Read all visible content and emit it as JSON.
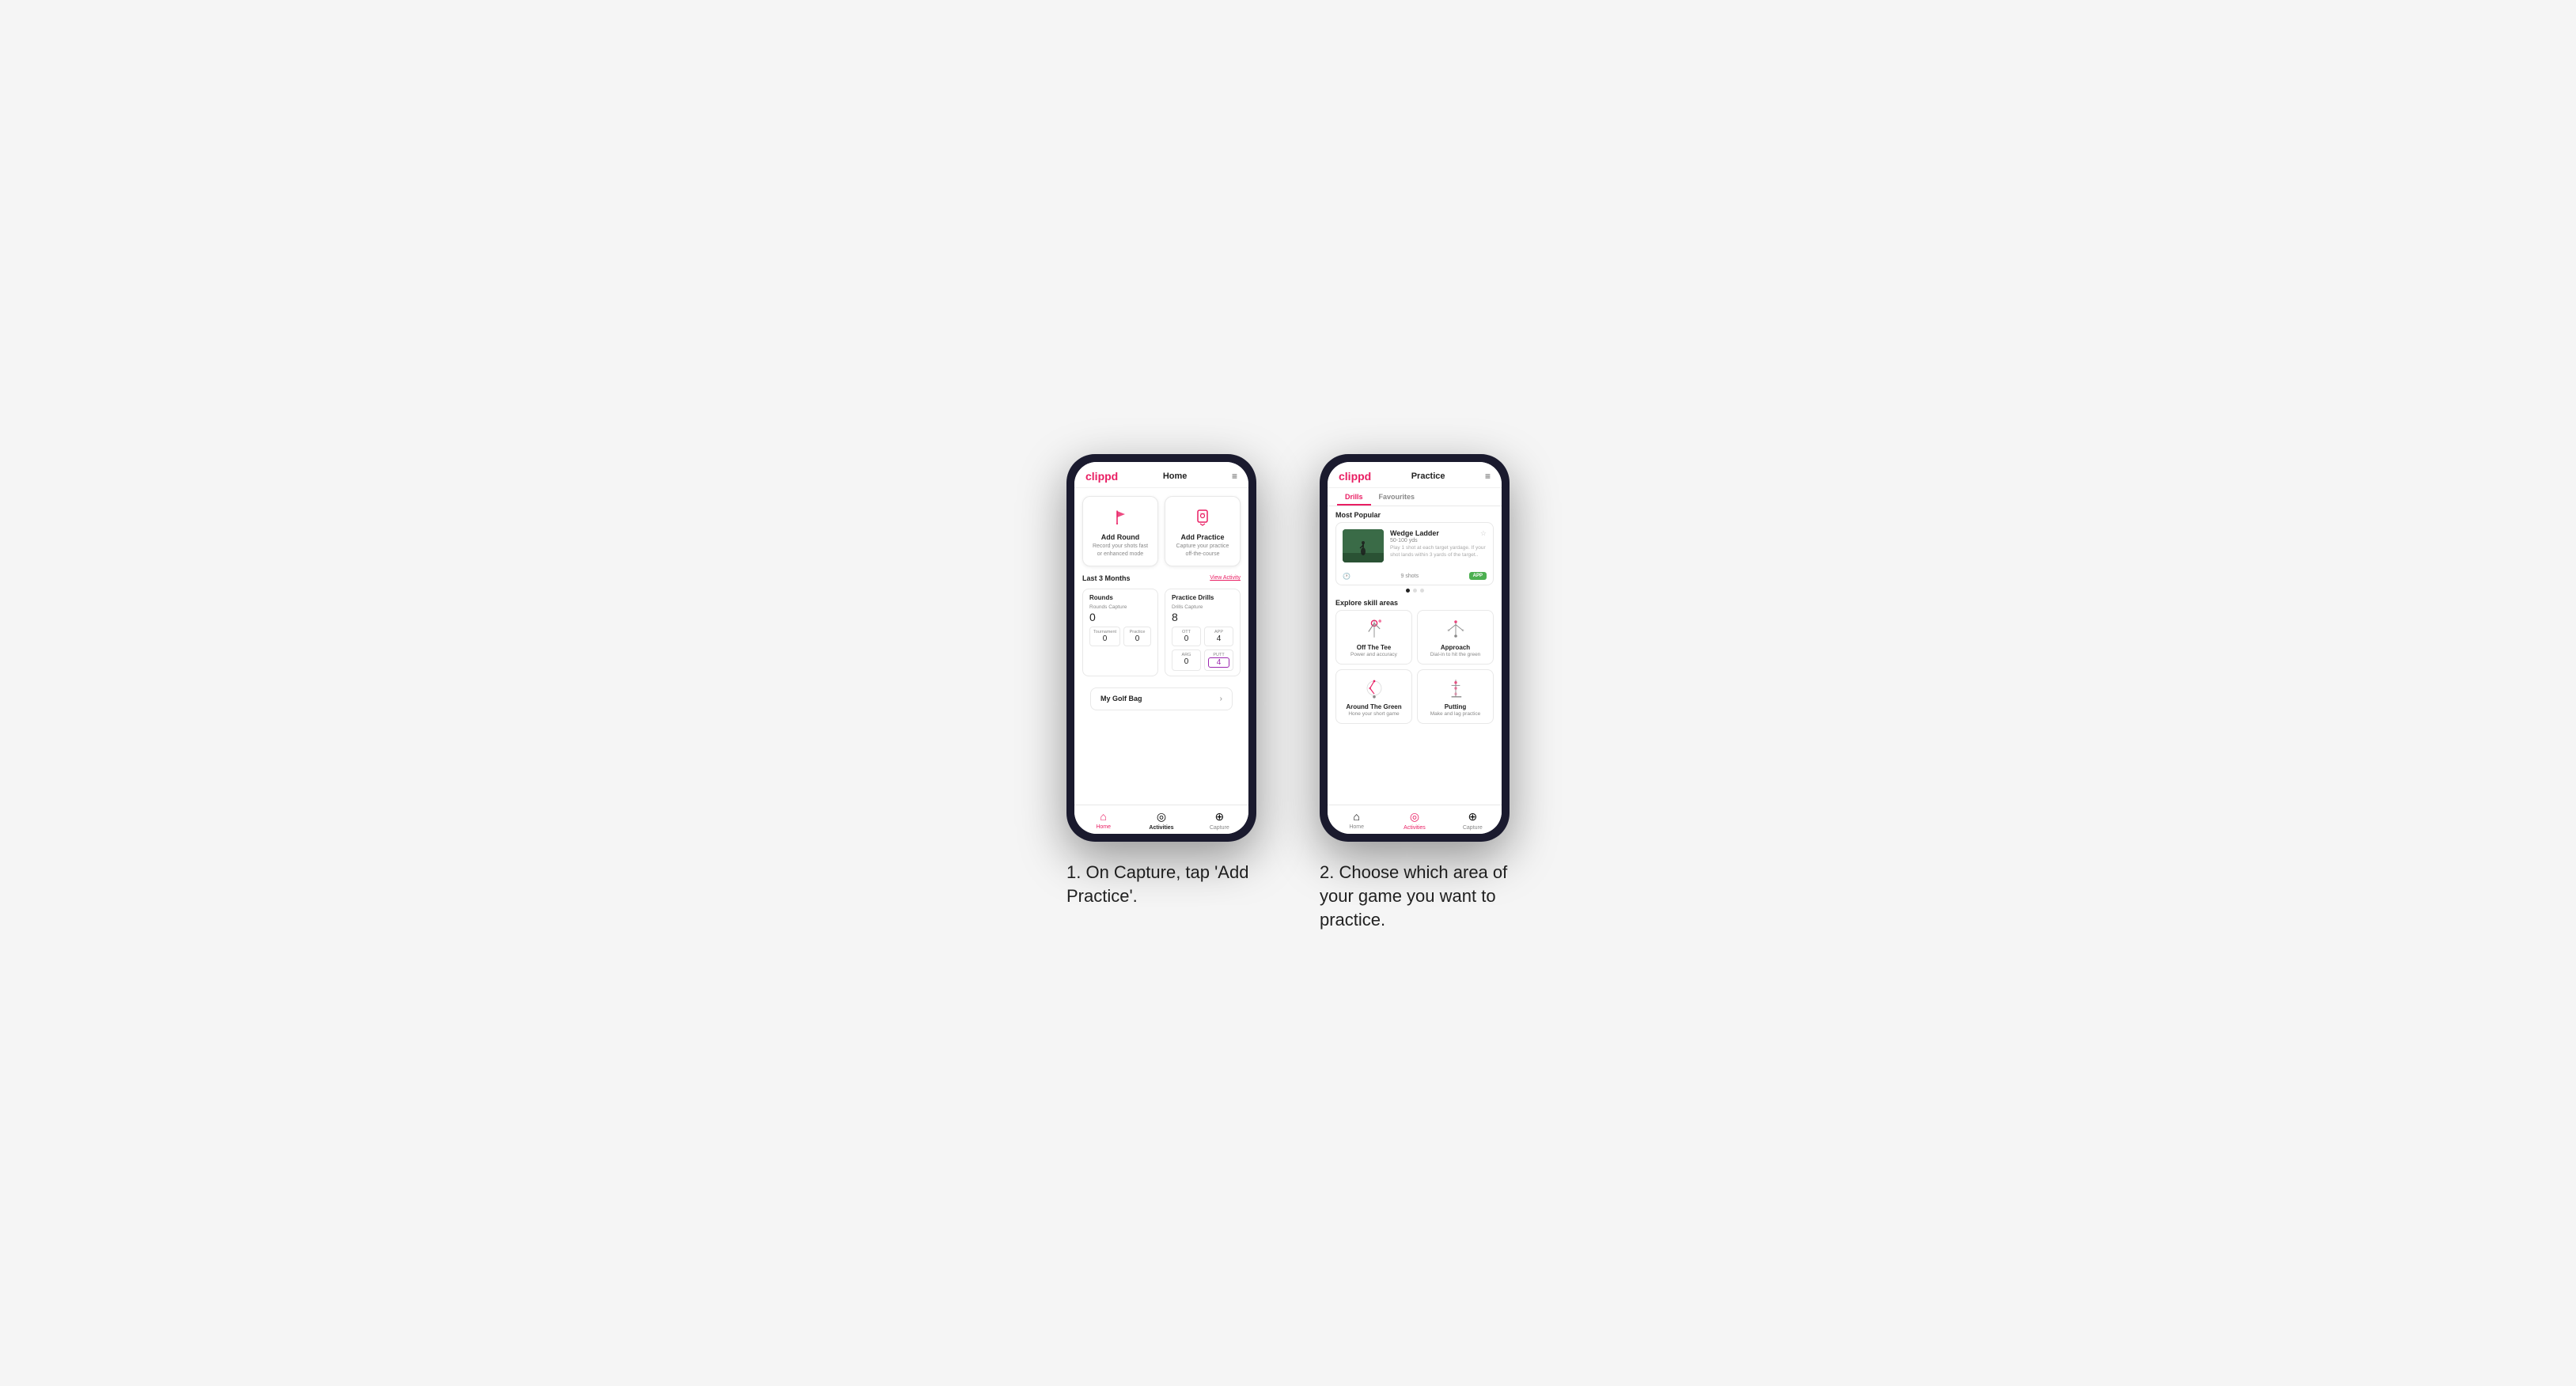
{
  "phones": [
    {
      "id": "phone1",
      "header": {
        "logo": "clippd",
        "title": "Home",
        "menu_icon": "≡"
      },
      "action_cards": [
        {
          "id": "add-round",
          "title": "Add Round",
          "description": "Record your shots fast or enhanced mode",
          "icon_type": "flag"
        },
        {
          "id": "add-practice",
          "title": "Add Practice",
          "description": "Capture your practice off-the-course",
          "icon_type": "badge"
        }
      ],
      "last_3_months": {
        "label": "Last 3 Months",
        "view_activity": "View Activity"
      },
      "rounds": {
        "section_title": "Rounds",
        "rounds_capture_label": "Rounds Capture",
        "rounds_capture_value": "0",
        "tournament_label": "Tournament",
        "tournament_value": "0",
        "practice_label": "Practice",
        "practice_value": "0",
        "ott_label": "OTT",
        "ott_value": "0",
        "app_label": "APP",
        "app_value": "4",
        "arg_label": "ARG",
        "arg_value": "0",
        "putt_label": "PUTT",
        "putt_value": "4"
      },
      "practice_drills": {
        "section_title": "Practice Drills",
        "drills_capture_label": "Drills Capture",
        "drills_capture_value": "8"
      },
      "golf_bag": {
        "label": "My Golf Bag"
      },
      "bottom_nav": [
        {
          "id": "home",
          "label": "Home",
          "icon": "⌂",
          "active": true
        },
        {
          "id": "activities",
          "label": "Activities",
          "icon": "◎",
          "active": false,
          "active2": true
        },
        {
          "id": "capture",
          "label": "Capture",
          "icon": "⊕",
          "active": false
        }
      ]
    },
    {
      "id": "phone2",
      "header": {
        "logo": "clippd",
        "title": "Practice",
        "menu_icon": "≡"
      },
      "tabs": [
        {
          "id": "drills",
          "label": "Drills",
          "active": true
        },
        {
          "id": "favourites",
          "label": "Favourites",
          "active": false
        }
      ],
      "most_popular_label": "Most Popular",
      "featured_drill": {
        "title": "Wedge Ladder",
        "yardage": "50-100 yds",
        "description": "Play 1 shot at each target yardage. If your shot lands within 3 yards of the target..",
        "shots": "9 shots",
        "badge": "APP"
      },
      "dots": [
        {
          "active": true
        },
        {
          "active": false
        },
        {
          "active": false
        }
      ],
      "explore_label": "Explore skill areas",
      "skill_areas": [
        {
          "id": "off-the-tee",
          "name": "Off The Tee",
          "description": "Power and accuracy",
          "icon_type": "tee"
        },
        {
          "id": "approach",
          "name": "Approach",
          "description": "Dial-in to hit the green",
          "icon_type": "approach"
        },
        {
          "id": "around-the-green",
          "name": "Around The Green",
          "description": "Hone your short game",
          "icon_type": "atg"
        },
        {
          "id": "putting",
          "name": "Putting",
          "description": "Make and lag practice",
          "icon_type": "putting"
        }
      ],
      "bottom_nav": [
        {
          "id": "home",
          "label": "Home",
          "icon": "⌂",
          "active": false
        },
        {
          "id": "activities",
          "label": "Activities",
          "icon": "◎",
          "active": true
        },
        {
          "id": "capture",
          "label": "Capture",
          "icon": "⊕",
          "active": false
        }
      ]
    }
  ],
  "captions": [
    {
      "id": "caption1",
      "text": "1. On Capture, tap 'Add Practice'."
    },
    {
      "id": "caption2",
      "text": "2. Choose which area of your game you want to practice."
    }
  ],
  "colors": {
    "brand_pink": "#e91e63",
    "brand_green": "#4caf50",
    "purple": "#9c27b0"
  }
}
